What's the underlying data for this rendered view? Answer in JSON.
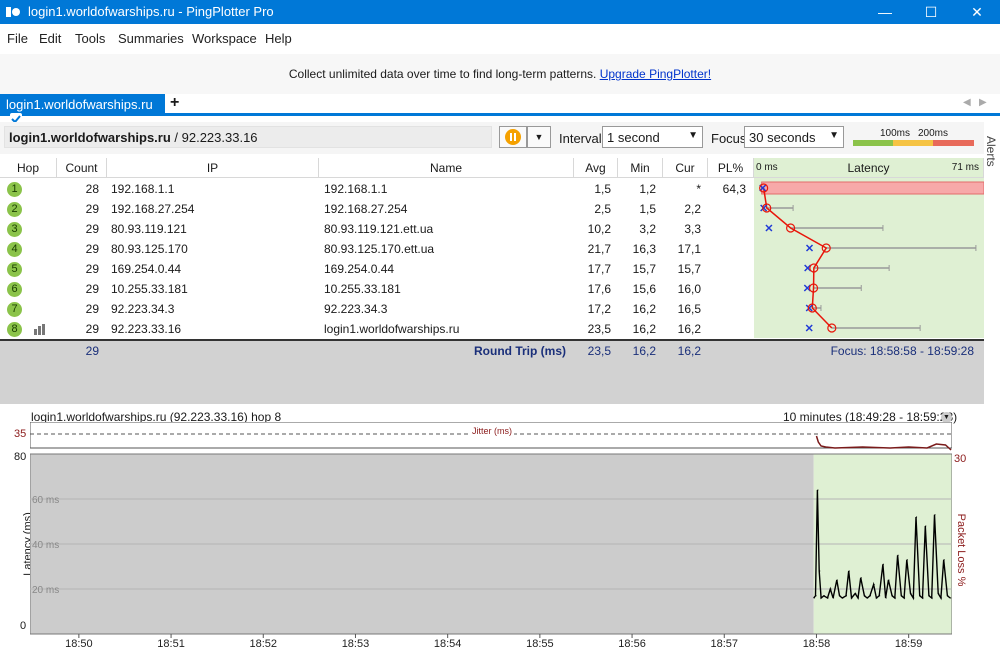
{
  "window": {
    "title": "login1.worldofwarships.ru - PingPlotter Pro",
    "minimize": "—",
    "maximize": "☐",
    "close": "✕"
  },
  "menu": [
    "File",
    "Edit",
    "Tools",
    "Summaries",
    "Workspace",
    "Help"
  ],
  "banner": {
    "text": "Collect unlimited data over time to find long-term patterns.",
    "link": "Upgrade PingPlotter!"
  },
  "tab": {
    "label": "login1.worldofwarships.ru",
    "add": "+"
  },
  "toolbar": {
    "target_host": "login1.worldofwarships.ru",
    "target_ip": " / 92.223.33.16",
    "interval_label": "Interval",
    "interval_value": "1 second",
    "focus_label": "Focus",
    "focus_value": "30 seconds",
    "legend_100": "100ms",
    "legend_200": "200ms"
  },
  "alerts_label": "Alerts",
  "grid": {
    "columns": {
      "hop": "Hop",
      "count": "Count",
      "ip": "IP",
      "name": "Name",
      "avg": "Avg",
      "min": "Min",
      "cur": "Cur",
      "pl": "PL%",
      "latency": "Latency",
      "lat_min": "0 ms",
      "lat_max": "71 ms"
    },
    "rows": [
      {
        "hop": "1",
        "count": "28",
        "ip": "192.168.1.1",
        "name": "192.168.1.1",
        "avg": "1,5",
        "min": "1,2",
        "cur": "*",
        "pl": "64,3"
      },
      {
        "hop": "2",
        "count": "29",
        "ip": "192.168.27.254",
        "name": "192.168.27.254",
        "avg": "2,5",
        "min": "1,5",
        "cur": "2,2",
        "pl": ""
      },
      {
        "hop": "3",
        "count": "29",
        "ip": "80.93.119.121",
        "name": "80.93.119.121.ett.ua",
        "avg": "10,2",
        "min": "3,2",
        "cur": "3,3",
        "pl": ""
      },
      {
        "hop": "4",
        "count": "29",
        "ip": "80.93.125.170",
        "name": "80.93.125.170.ett.ua",
        "avg": "21,7",
        "min": "16,3",
        "cur": "17,1",
        "pl": ""
      },
      {
        "hop": "5",
        "count": "29",
        "ip": "169.254.0.44",
        "name": "169.254.0.44",
        "avg": "17,7",
        "min": "15,7",
        "cur": "15,7",
        "pl": ""
      },
      {
        "hop": "6",
        "count": "29",
        "ip": "10.255.33.181",
        "name": "10.255.33.181",
        "avg": "17,6",
        "min": "15,6",
        "cur": "16,0",
        "pl": ""
      },
      {
        "hop": "7",
        "count": "29",
        "ip": "92.223.34.3",
        "name": "92.223.34.3",
        "avg": "17,2",
        "min": "16,2",
        "cur": "16,5",
        "pl": ""
      },
      {
        "hop": "8",
        "count": "29",
        "ip": "92.223.33.16",
        "name": "login1.worldofwarships.ru",
        "avg": "23,5",
        "min": "16,2",
        "cur": "16,2",
        "pl": ""
      }
    ],
    "summary": {
      "count": "29",
      "label": "Round Trip (ms)",
      "avg": "23,5",
      "min": "16,2",
      "cur": "16,2",
      "focus": "Focus: 18:58:58 - 18:59:28"
    }
  },
  "chart_data": {
    "type": "line",
    "title": "login1.worldofwarships.ru (92.223.33.16) hop 8",
    "time_range": "10 minutes (18:49:28 - 18:59:28)",
    "jitter_label": "Jitter (ms)",
    "jitter_max": "35",
    "ylabel": "Latency (ms)",
    "y2label": "Packet Loss %",
    "y2_max": "30",
    "ylim": [
      0,
      80
    ],
    "y_top_label": "80",
    "y_zero_label": "0",
    "y_gridlines": [
      {
        "value": 60,
        "label": "60 ms"
      },
      {
        "value": 40,
        "label": "40 ms"
      },
      {
        "value": 20,
        "label": "20 ms"
      }
    ],
    "x_ticks": [
      "18:50",
      "18:51",
      "18:52",
      "18:53",
      "18:54",
      "18:55",
      "18:56",
      "18:57",
      "18:58",
      "18:59"
    ],
    "x_range_minutes": [
      49.47,
      59.47
    ],
    "data_start_minute": 57.97,
    "series": [
      {
        "values": [
          [
            57.97,
            16
          ],
          [
            57.99,
            17
          ],
          [
            58.01,
            64
          ],
          [
            58.03,
            28
          ],
          [
            58.05,
            16
          ],
          [
            58.08,
            17
          ],
          [
            58.12,
            16
          ],
          [
            58.15,
            20
          ],
          [
            58.18,
            16
          ],
          [
            58.22,
            24
          ],
          [
            58.25,
            17
          ],
          [
            58.28,
            16
          ],
          [
            58.32,
            17
          ],
          [
            58.35,
            28
          ],
          [
            58.38,
            16
          ],
          [
            58.42,
            18
          ],
          [
            58.45,
            16
          ],
          [
            58.48,
            25
          ],
          [
            58.52,
            17
          ],
          [
            58.55,
            16
          ],
          [
            58.58,
            17
          ],
          [
            58.62,
            22
          ],
          [
            58.65,
            16
          ],
          [
            58.68,
            17
          ],
          [
            58.72,
            31
          ],
          [
            58.75,
            16
          ],
          [
            58.78,
            24
          ],
          [
            58.82,
            17
          ],
          [
            58.85,
            16
          ],
          [
            58.88,
            35
          ],
          [
            58.92,
            17
          ],
          [
            58.95,
            16
          ],
          [
            58.98,
            33
          ],
          [
            59.02,
            18
          ],
          [
            59.05,
            16
          ],
          [
            59.08,
            52
          ],
          [
            59.12,
            17
          ],
          [
            59.15,
            16
          ],
          [
            59.18,
            48
          ],
          [
            59.22,
            17
          ],
          [
            59.25,
            16
          ],
          [
            59.28,
            53
          ],
          [
            59.32,
            18
          ],
          [
            59.35,
            16
          ],
          [
            59.38,
            33
          ],
          [
            59.42,
            17
          ],
          [
            59.45,
            16
          ]
        ]
      }
    ],
    "hop_minmax": [
      {
        "hop": 1,
        "min": 1.2,
        "avg": 1.5,
        "max": 1.5,
        "loss_bar": true
      },
      {
        "hop": 2,
        "min": 1.5,
        "avg": 2.5,
        "max": 11
      },
      {
        "hop": 3,
        "min": 3.2,
        "avg": 10.2,
        "max": 40
      },
      {
        "hop": 4,
        "min": 16.3,
        "avg": 21.7,
        "max": 70
      },
      {
        "hop": 5,
        "min": 15.7,
        "avg": 17.7,
        "max": 42
      },
      {
        "hop": 6,
        "min": 15.6,
        "avg": 17.6,
        "max": 33
      },
      {
        "hop": 7,
        "min": 16.2,
        "avg": 17.2,
        "max": 20
      },
      {
        "hop": 8,
        "min": 16.2,
        "avg": 23.5,
        "max": 52
      }
    ],
    "latency_axis_max": 71
  },
  "colors": {
    "accent": "#0078d7",
    "good": "#dff0d3",
    "loss": "#f7a9a9",
    "line": "#e8150a",
    "min_marker": "#1f3ad6",
    "chart_bg_gray": "#cccccc"
  }
}
